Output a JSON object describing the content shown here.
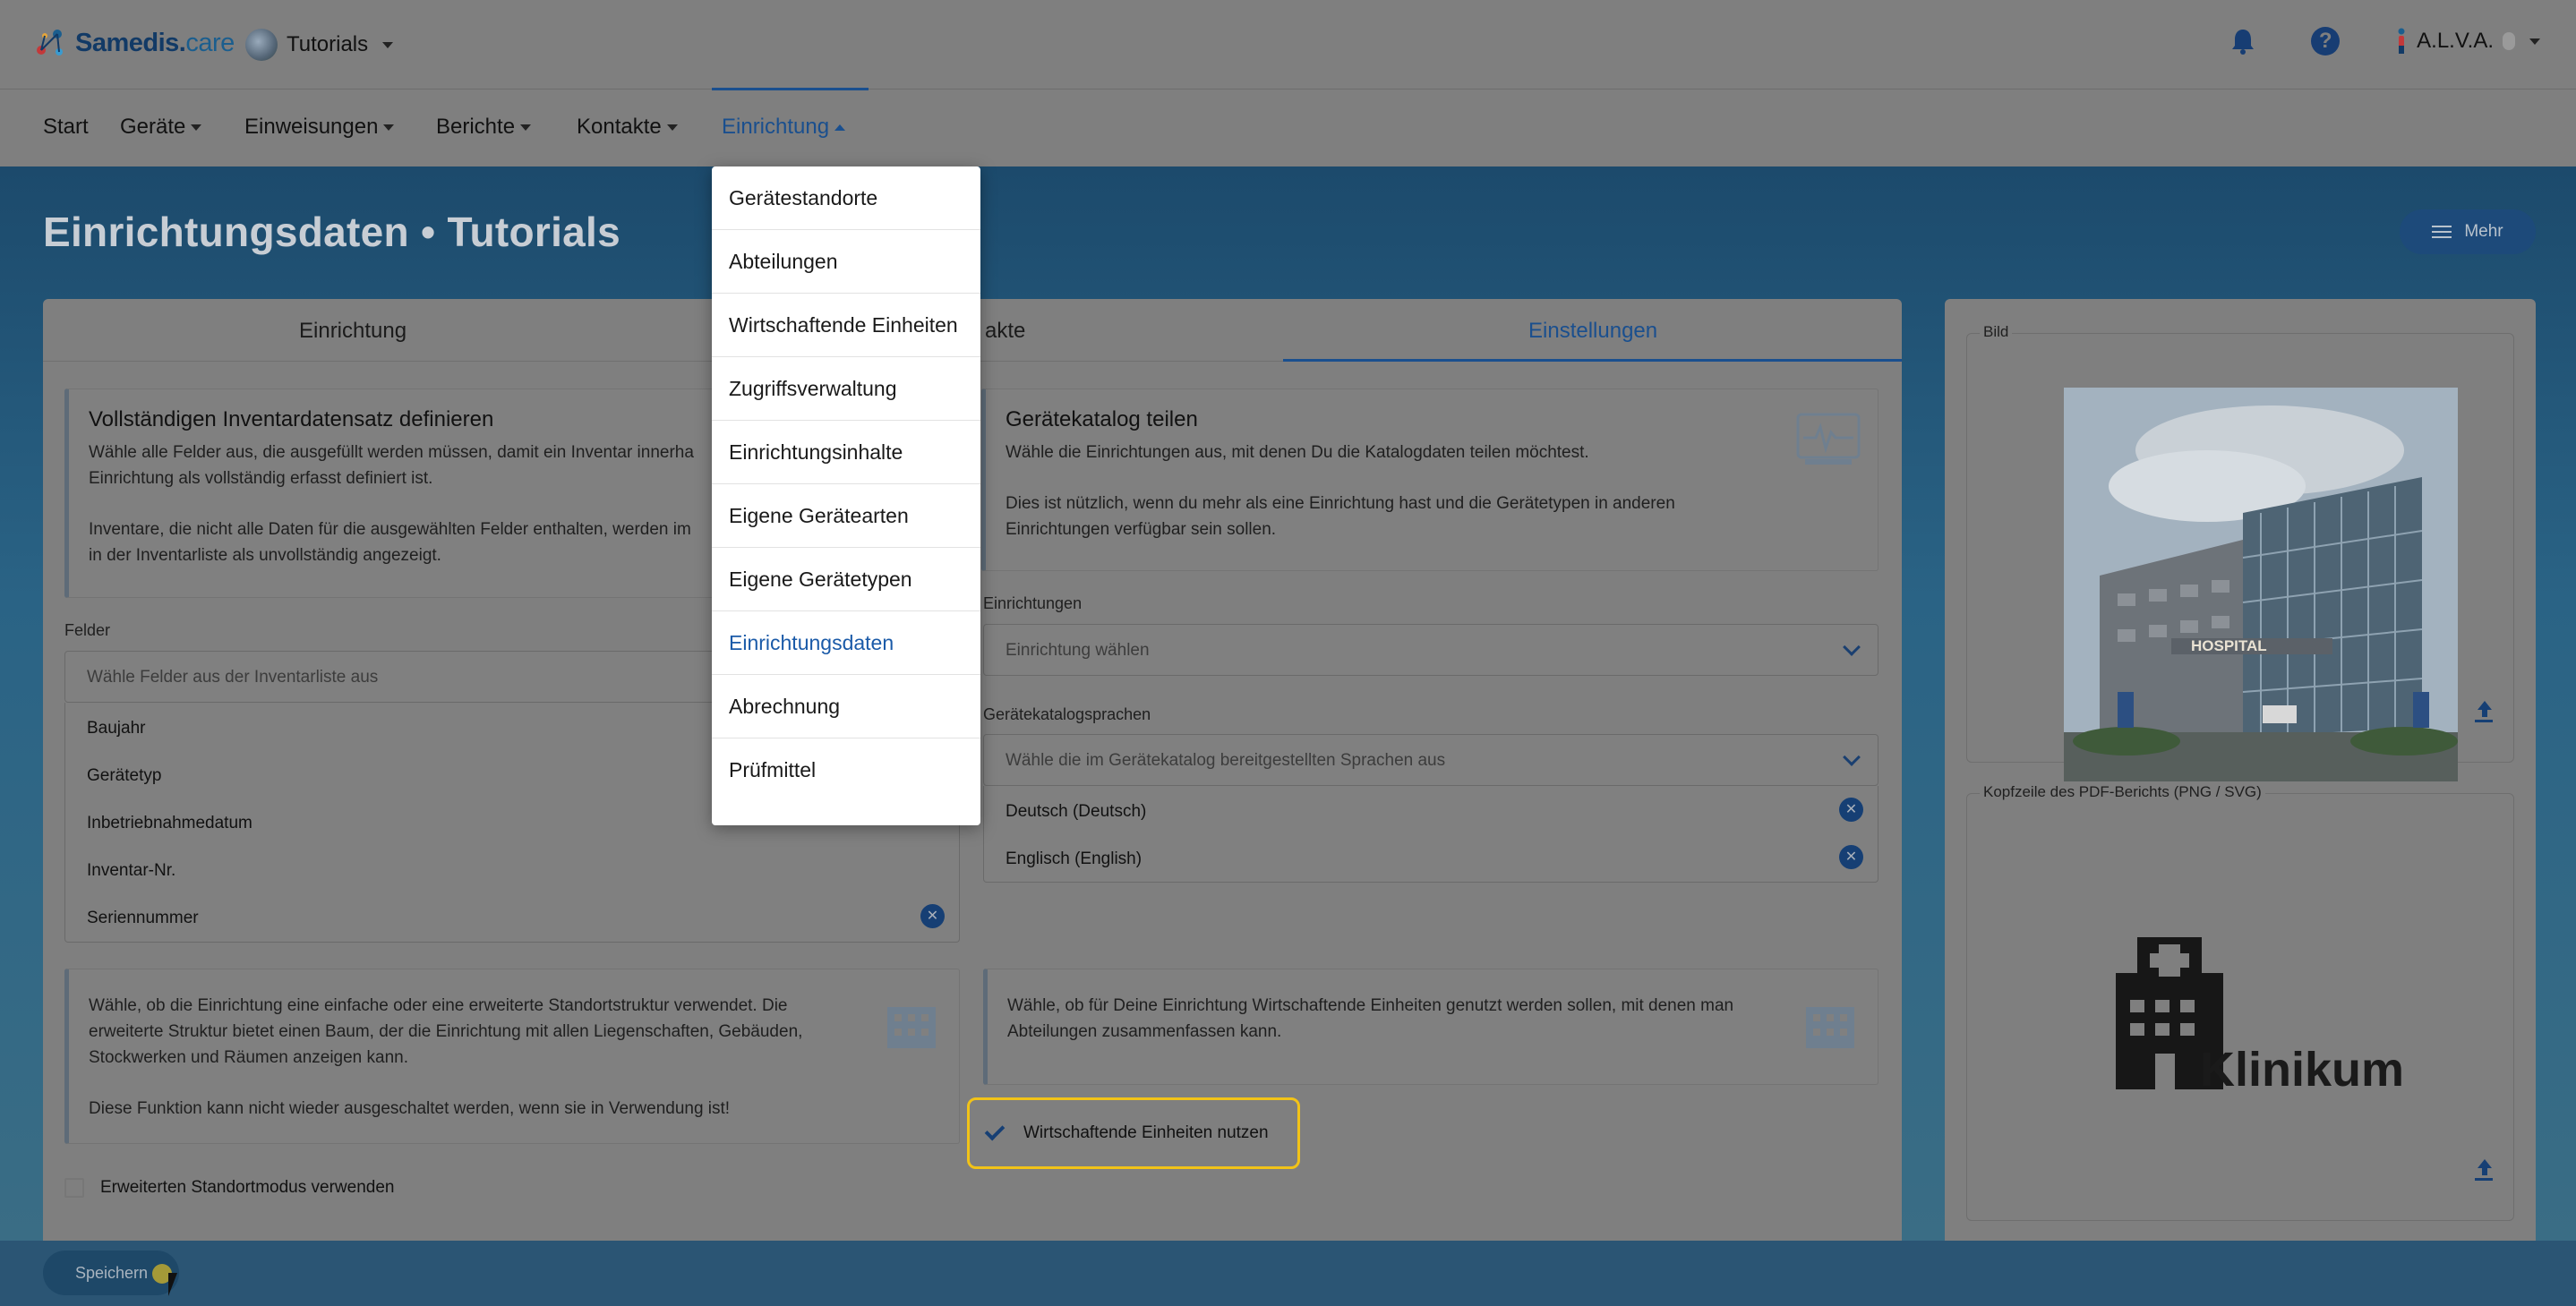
{
  "app": {
    "brand": "Samedis.",
    "brand_suffix": "care",
    "tenant": "Tutorials",
    "user": "A.L.V.A."
  },
  "nav": {
    "items": [
      {
        "label": "Start",
        "dropdown": false
      },
      {
        "label": "Geräte",
        "dropdown": true
      },
      {
        "label": "Einweisungen",
        "dropdown": true
      },
      {
        "label": "Berichte",
        "dropdown": true
      },
      {
        "label": "Kontakte",
        "dropdown": true
      },
      {
        "label": "Einrichtung",
        "dropdown": true,
        "active": true
      }
    ]
  },
  "dropdown": {
    "items": [
      "Gerätestandorte",
      "Abteilungen",
      "Wirtschaftende Einheiten",
      "Zugriffsverwaltung",
      "Einrichtungsinhalte",
      "Eigene Gerätearten",
      "Eigene Gerätetypen",
      "Einrichtungsdaten",
      "Abrechnung",
      "Prüfmittel"
    ],
    "active": "Einrichtungsdaten"
  },
  "page": {
    "title": "Einrichtungsdaten • Tutorials",
    "more_label": "Mehr"
  },
  "tabs": {
    "einrichtung": "Einrichtung",
    "kontakte_partial": "akte",
    "einstellungen": "Einstellungen"
  },
  "left": {
    "inventory_box": {
      "title": "Vollständigen Inventardatensatz definieren",
      "p1a": "Wähle alle Felder aus, die ausgefüllt werden müssen, damit ein Inventar innerha",
      "p1b": "Einrichtung als vollständig erfasst definiert ist.",
      "p2a": "Inventare, die nicht alle Daten für die ausgewählten Felder enthalten, werden im",
      "p2b": "in der Inventarliste als unvollständig angezeigt."
    },
    "fields_label": "Felder",
    "fields_placeholder": "Wähle Felder aus der Inventarliste aus",
    "fields": [
      "Baujahr",
      "Gerätetyp",
      "Inbetriebnahmedatum",
      "Inventar-Nr.",
      "Seriennummer"
    ],
    "location_box": {
      "p1a": "Wähle, ob die Einrichtung eine einfache oder eine erweiterte Standortstruktur verwendet. Die",
      "p1b": "erweiterte Struktur bietet einen Baum, der die Einrichtung mit allen Liegenschaften, Gebäuden,",
      "p1c": "Stockwerken und Räumen anzeigen kann.",
      "p2": "Diese Funktion kann nicht wieder ausgeschaltet werden, wenn sie in Verwendung ist!"
    },
    "extended_location_label": "Erweiterten Standortmodus verwenden"
  },
  "mid": {
    "catalog_box": {
      "title": "Gerätekatalog teilen",
      "p1": "Wähle die Einrichtungen aus, mit denen Du die Katalogdaten teilen möchtest.",
      "p2a": "Dies ist nützlich, wenn du mehr als eine Einrichtung hast und die Gerätetypen in anderen",
      "p2b": "Einrichtungen verfügbar sein sollen."
    },
    "facilities_label": "Einrichtungen",
    "facilities_placeholder": "Einrichtung wählen",
    "languages_label": "Gerätekatalogsprachen",
    "languages_placeholder": "Wähle die im Gerätekatalog bereitgestellten Sprachen aus",
    "languages": [
      "Deutsch (Deutsch)",
      "Englisch (English)"
    ],
    "units_box": {
      "p1a": "Wähle, ob für Deine Einrichtung Wirtschaftende Einheiten genutzt werden sollen, mit denen man",
      "p1b": "Abteilungen zusammenfassen kann."
    },
    "units_checkbox_label": "Wirtschaftende Einheiten nutzen",
    "units_checked": true
  },
  "right": {
    "image_label": "Bild",
    "hospital_sign": "HOSPITAL",
    "pdf_header_label": "Kopfzeile des PDF-Berichts (PNG / SVG)",
    "pdf_logo_text": "Klinikum"
  },
  "footer": {
    "save_label": "Speichern"
  },
  "colors": {
    "accent": "#1a4f8e",
    "highlight": "#f2c318",
    "overlay_gray": "#7f7f7f"
  }
}
